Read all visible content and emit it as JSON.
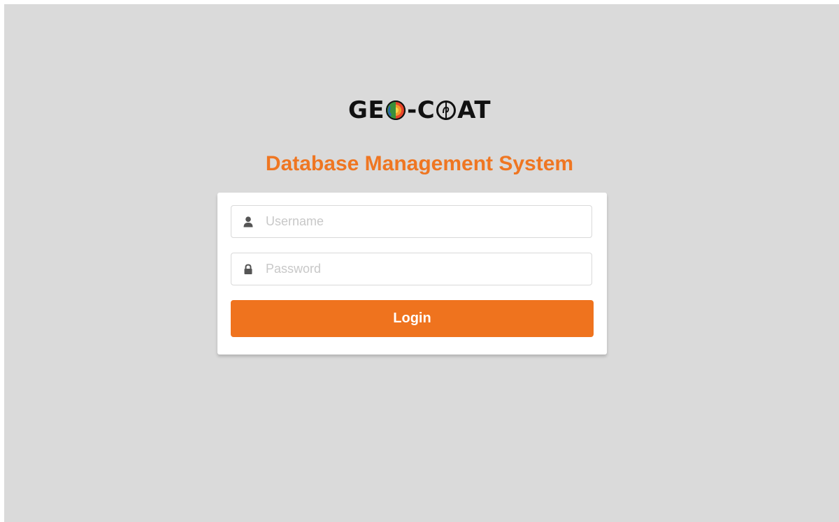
{
  "brand": {
    "logo_part1": "GE",
    "logo_part2": "-C",
    "logo_part3": "AT",
    "logo_globe_icon": "earth-core-globe-icon",
    "logo_ring_icon": "circular-symbol-icon"
  },
  "header": {
    "title": "Database Management System",
    "title_color": "#ef7622"
  },
  "login_form": {
    "username": {
      "icon": "user-icon",
      "placeholder": "Username",
      "value": ""
    },
    "password": {
      "icon": "lock-icon",
      "placeholder": "Password",
      "value": ""
    },
    "submit_label": "Login",
    "submit_color": "#ef731e"
  },
  "colors": {
    "background": "#dadada",
    "card": "#ffffff"
  }
}
